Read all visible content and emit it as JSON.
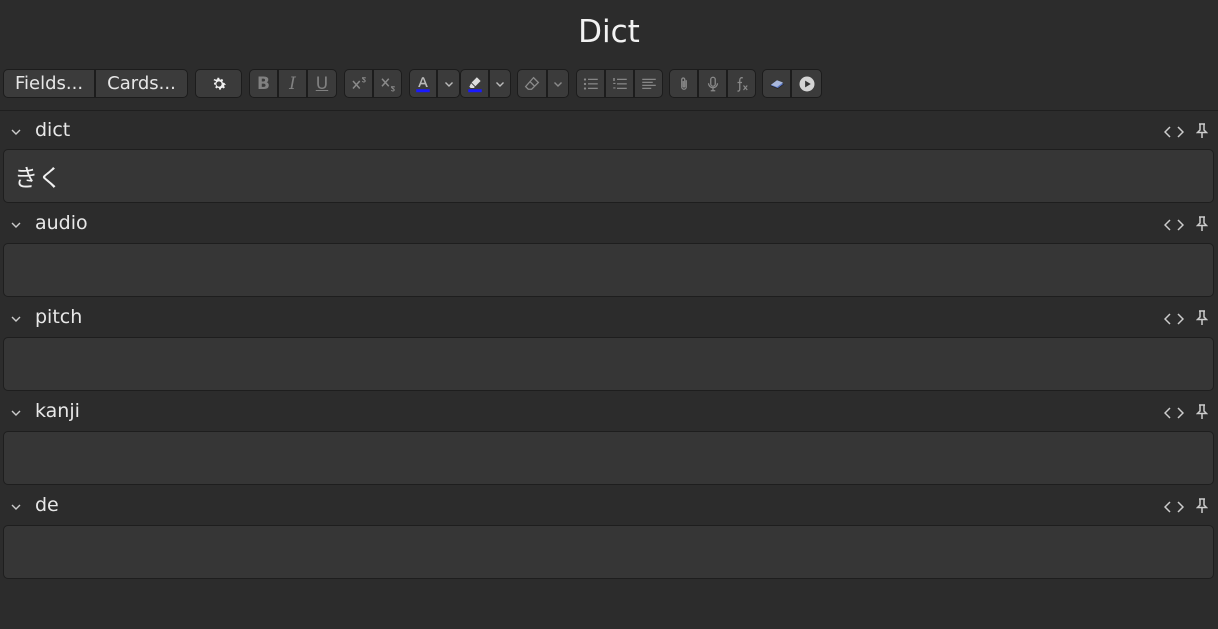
{
  "window": {
    "title": "Dict"
  },
  "toolbar": {
    "fields_label": "Fields...",
    "cards_label": "Cards...",
    "bold_label": "B",
    "italic_label": "I",
    "underline_label": "U",
    "text_color": "#1a1aff",
    "highlight_color": "#1a1aff"
  },
  "fields": [
    {
      "name": "dict",
      "value": "きく"
    },
    {
      "name": "audio",
      "value": ""
    },
    {
      "name": "pitch",
      "value": ""
    },
    {
      "name": "kanji",
      "value": ""
    },
    {
      "name": "de",
      "value": ""
    }
  ]
}
